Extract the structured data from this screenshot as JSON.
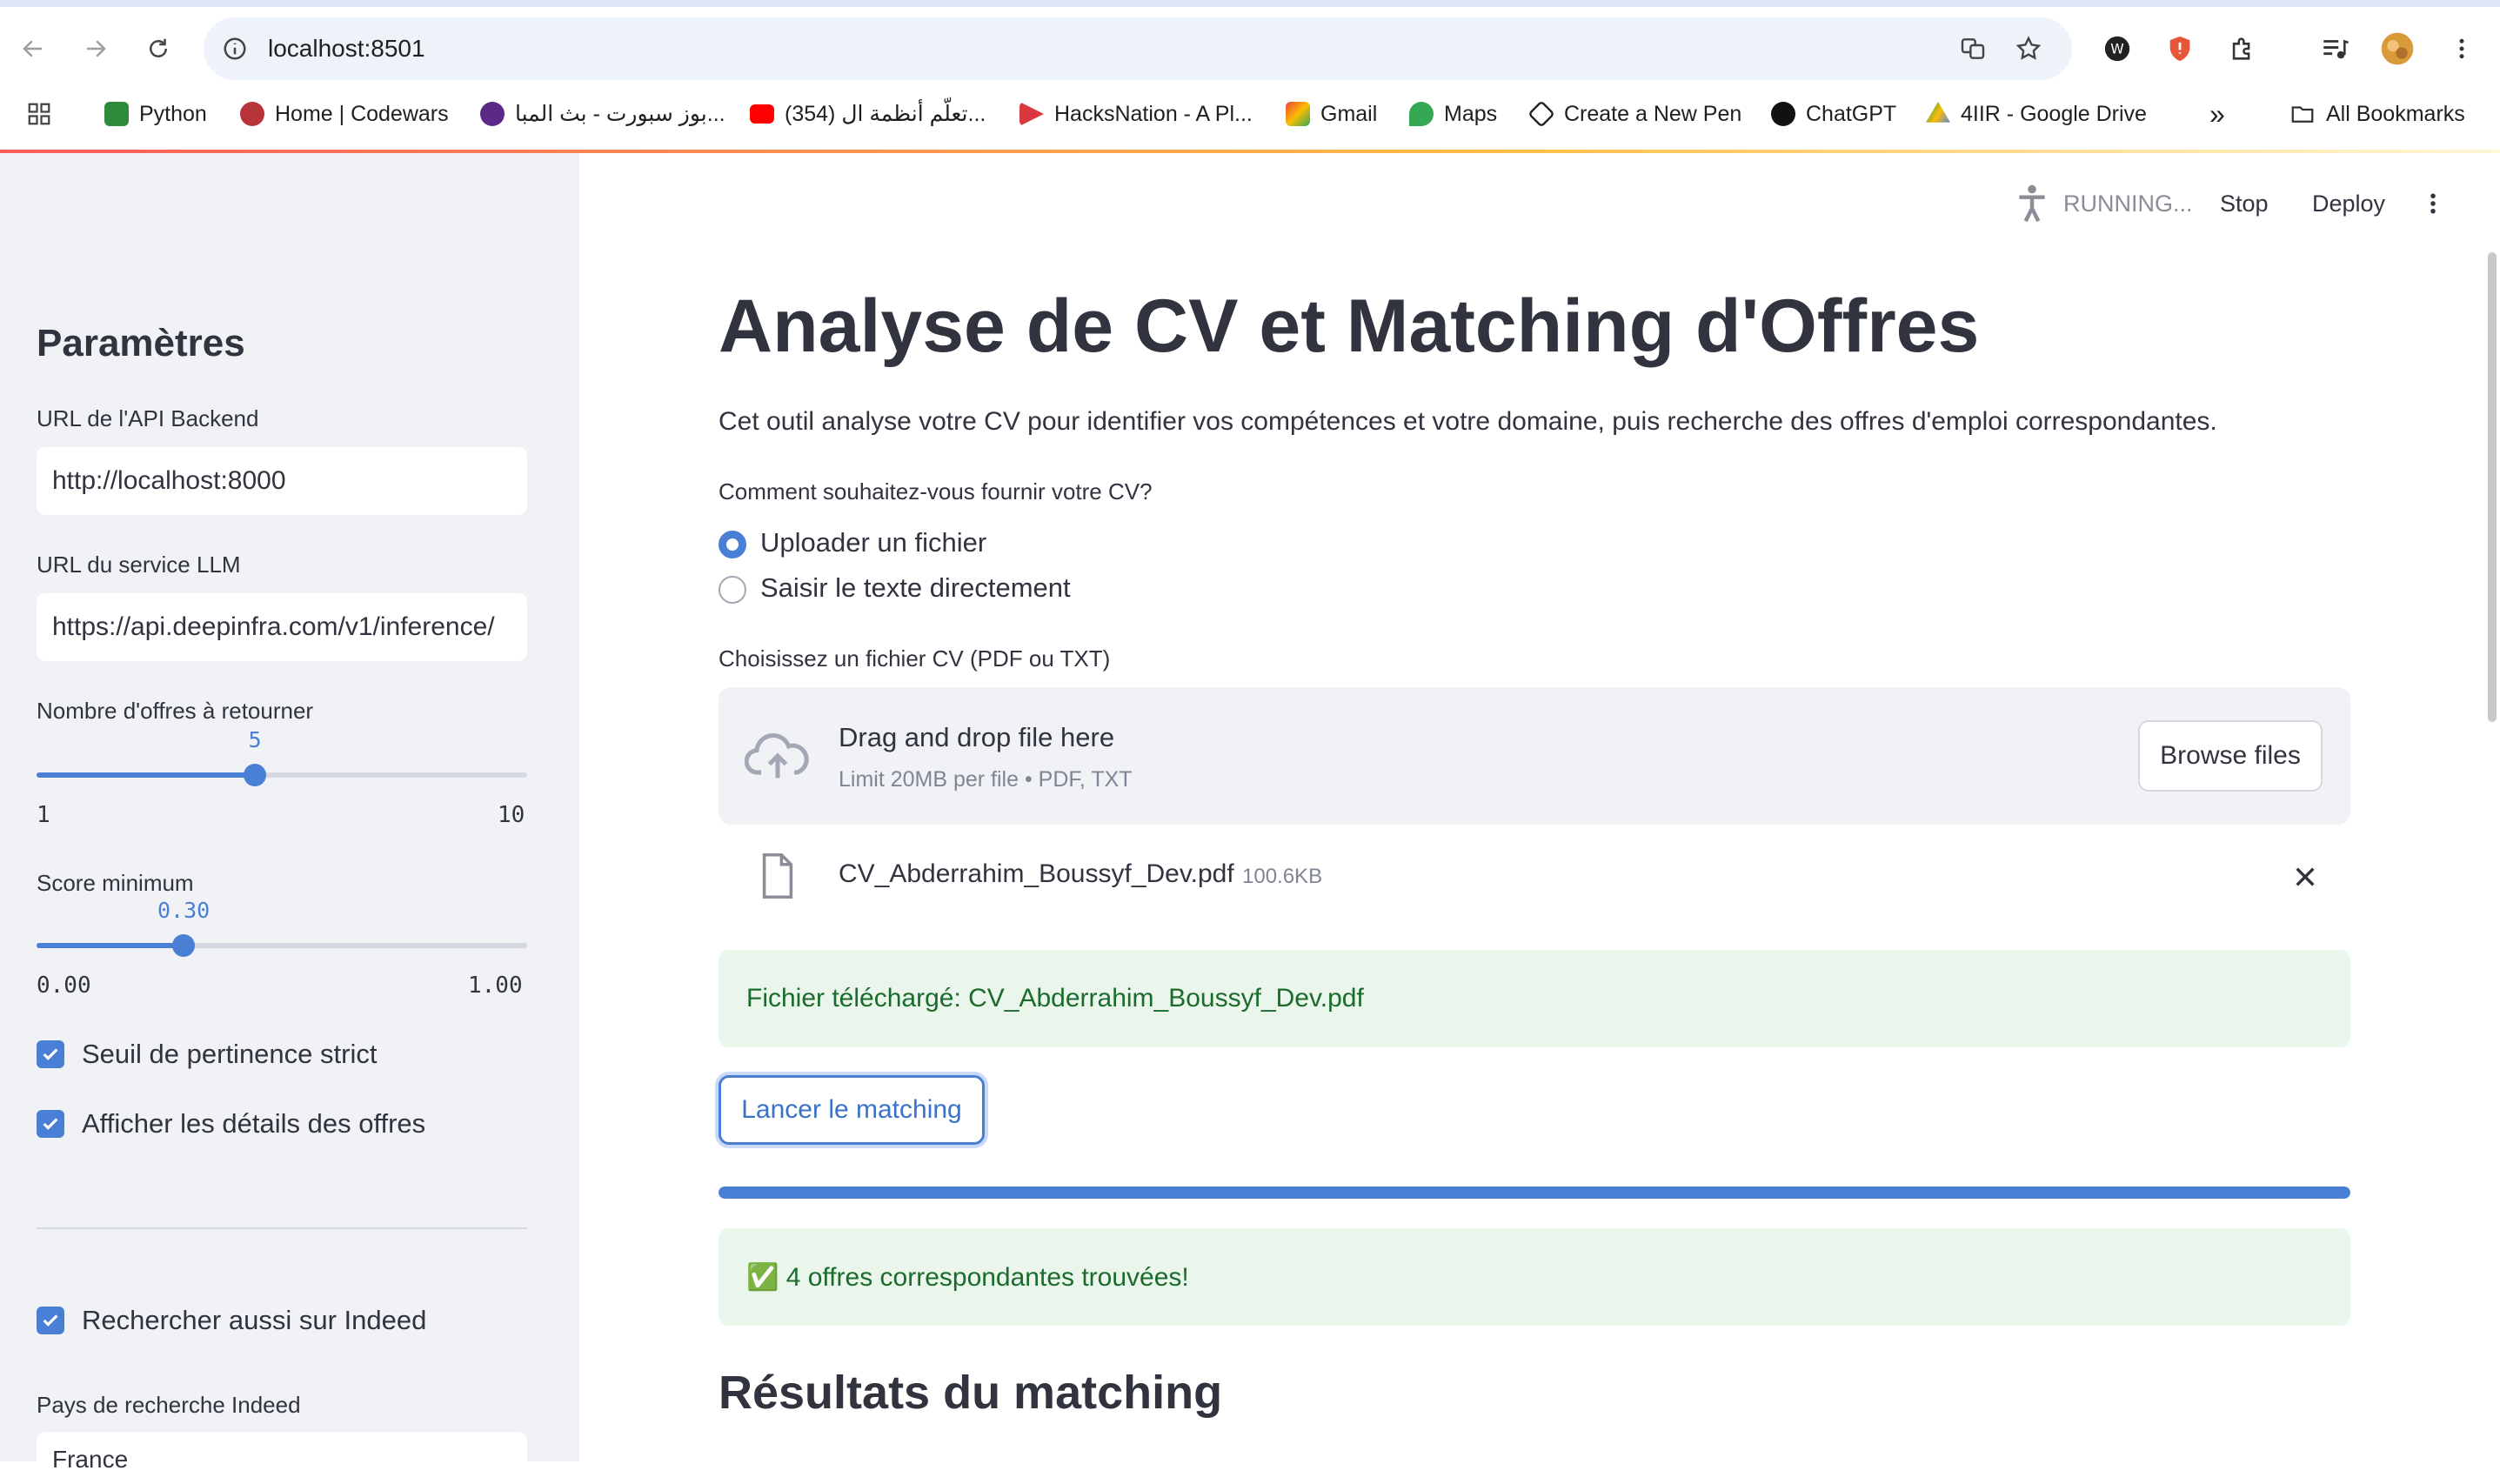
{
  "browser": {
    "url": "localhost:8501",
    "bookmarks": [
      "Python",
      "Home | Codewars",
      "بوز سبورت - بث المبا...",
      "(354) تعلّم أنظمة ال...",
      "HacksNation - A Pl...",
      "Gmail",
      "Maps",
      "Create a New Pen",
      "ChatGPT",
      "4IIR - Google Drive"
    ],
    "more_bookmarks": "»",
    "all_bookmarks": "All Bookmarks"
  },
  "header": {
    "status": "RUNNING...",
    "stop": "Stop",
    "deploy": "Deploy"
  },
  "sidebar": {
    "title": "Paramètres",
    "api_url_label": "URL de l'API Backend",
    "api_url_value": "http://localhost:8000",
    "llm_url_label": "URL du service LLM",
    "llm_url_value": "https://api.deepinfra.com/v1/inference/",
    "offers_label": "Nombre d'offres à retourner",
    "offers_value": "5",
    "offers_value_num": 5,
    "offers_min": "1",
    "offers_max": "10",
    "score_label": "Score minimum",
    "score_value": "0.30",
    "score_value_num": 0.3,
    "score_min": "0.00",
    "score_max": "1.00",
    "strict_label": "Seuil de pertinence strict",
    "details_label": "Afficher les détails des offres",
    "indeed_label": "Rechercher aussi sur Indeed",
    "country_label": "Pays de recherche Indeed",
    "country_value": "France"
  },
  "main": {
    "title": "Analyse de CV et Matching d'Offres",
    "description": "Cet outil analyse votre CV pour identifier vos compétences et votre domaine, puis recherche des offres d'emploi correspondantes.",
    "question": "Comment souhaitez-vous fournir votre CV?",
    "option_upload": "Uploader un fichier",
    "option_text": "Saisir le texte directement",
    "file_label": "Choisissez un fichier CV (PDF ou TXT)",
    "dropzone_title": "Drag and drop file here",
    "dropzone_limit": "Limit 20MB per file • PDF, TXT",
    "browse": "Browse files",
    "file_name": "CV_Abderrahim_Boussyf_Dev.pdf",
    "file_size": "100.6KB",
    "uploaded_msg": "Fichier téléchargé: CV_Abderrahim_Boussyf_Dev.pdf",
    "match_button": "Lancer le matching",
    "progress": 1.0,
    "success_msg": "✅ 4 offres correspondantes trouvées!",
    "results_title": "Résultats du matching"
  },
  "colors": {
    "accent": "#4a7fd6",
    "sidebar_bg": "#f0f2f6",
    "success_bg": "#eaf6ec",
    "success_text": "#1a6b2c"
  }
}
